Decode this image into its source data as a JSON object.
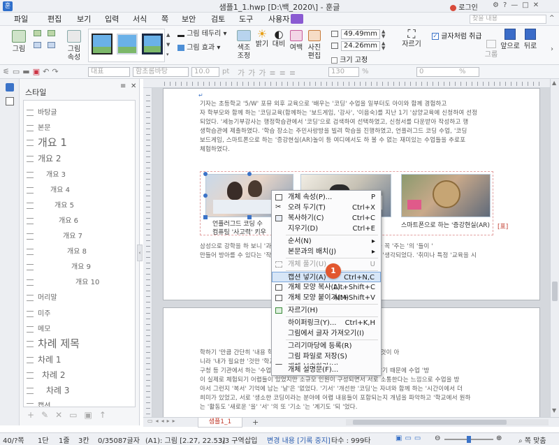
{
  "window": {
    "title": "샘플1_1.hwp [D:\\백_2020\\] - 훈글",
    "login_label": "로그인",
    "search_placeholder": "찾을 내용"
  },
  "menu": [
    "파일",
    "편집",
    "보기",
    "입력",
    "서식",
    "쪽",
    "보안",
    "검토",
    "도구",
    "사용자"
  ],
  "ribbon": {
    "picture": "그림",
    "picture_props_1": "그림",
    "picture_props_2": "속성",
    "border": "그림 테두리",
    "effect": "그림 효과",
    "color_adjust_1": "색조",
    "color_adjust_2": "조정",
    "brightness": "밝기",
    "contrast": "대비",
    "margin": "여백",
    "photo_edit_1": "사진",
    "photo_edit_2": "편집",
    "width_value": "49.49",
    "height_value": "24.26",
    "unit": "mm",
    "fix_size": "크기 고정",
    "crop": "자르기",
    "treat_as_text": "글자처럼 취급",
    "group": "그룹",
    "front": "앞으로",
    "back": "뒤로"
  },
  "toolbar": {
    "style": "대표",
    "font": "함초롬바탕",
    "size": "10.0",
    "size_unit": "pt",
    "line_spacing": "130",
    "line_spacing_unit": "%",
    "char_spacing": "0",
    "char_spacing_unit": "%"
  },
  "sidebar": {
    "title": "스타일",
    "styles": [
      "바탕글",
      "본문",
      "개요 1",
      "개요 2",
      "개요 3",
      "개요 4",
      "개요 5",
      "개요 6",
      "개요 7",
      "개요 8",
      "개요 9",
      "개요 10",
      "머리말",
      "미주",
      "메모",
      "차례 제목",
      "차례 1",
      "차례 2",
      "차례 3",
      "캡션"
    ]
  },
  "document": {
    "para1": [
      "기자는 초등학교 '5/W' 포뮤 외후 교육으로 '배우는 '코딩' 수업을 일부터도 아이와 함께 경험하고",
      "자 학부모와 함께 하는 '코딩교육(함께하는 '보드게임, '강사', '이음숙)를 지난 1기 '삼양교육에 신청하여 선정",
      "되었다. '세능기부강사는 행정학습관에서 '코딩'으로 검색하여 선택하였고, 신청서를 다운받아 작성하고 행",
      "생학습관에 제출하였다. '학습 장소는 주민사랑방을 빌려 학습을 진행하였고, 언플러그드 코딩 수업, '코딩",
      "보드게임, 스마트폰으로 하는 '증강현실(AR)놀이 등 여디에서도 하 볼 수 없는 재미있는 수업들을 추로포",
      "체험하였다."
    ],
    "caption_left_1": "언플러그드 코딩 수",
    "caption_left_2": "컴퓨팅 '사고력' 키우",
    "caption_right": "스마트폰으로 하는 '증강현실(AR)",
    "table_mark": "[표]",
    "para2": [
      "삼성으로 강학을 하 보니 '과정의 질 '프로그램 소개이다. 이러한 '기회를 꼭 '주는 '의 '들이 '",
      "만들어 방아를 수 있다는 '작은 기대 한 작은 모든 '프로그램을 입학하고 '생각되었다. '취미나 특정 '교육을 시"
    ],
    "para3": [
      "학하기 '만큼 간단히 '내용 학 '그림 '수도 '있고, 대단한 '내용을 배우는 것이 아",
      "니라 '내가 필요한 '것만 '학교 '수업 공부를 '해",
      "구청 등 기관에서 하는 '수업은 '대체 '분 '한 '모집 '은 '인원이 교육을 받기 때문에 수업 '방",
      "이 실제로 체험되기 어렵들이 있었지만 소규모 인원이 구성되면서 서로 소통한다는 느낌으로 수업을 방",
      "아서 그런지 '복서' 기억에 남는 '날'은 '없었다. '기서' '개선한 '코딩'는 자녀와 함께 하는 '시간이에서 더",
      "희미가 있었고, 서로 '생소한 코딩이라는 분야에 어렵 내용들이 포함되는지 개념을 파악하고 '학교에서 원하",
      "는 '활동도 '새로운 '을' '서' '의 또 '기소 '는 '계기도 '되 '었다."
    ]
  },
  "context_menu": {
    "items": [
      {
        "label": "개체 속성(P)...",
        "shortcut": "P",
        "icon": "properties-icon",
        "disabled": false,
        "highlight": false
      },
      {
        "label": "오려 두기(T)",
        "shortcut": "Ctrl+X",
        "icon": "scissors-icon",
        "disabled": false,
        "highlight": false
      },
      {
        "label": "복사하기(C)",
        "shortcut": "Ctrl+C",
        "icon": "copy-icon",
        "disabled": false,
        "highlight": false
      },
      {
        "label": "지우기(D)",
        "shortcut": "Ctrl+E",
        "icon": "",
        "disabled": false,
        "highlight": false
      },
      {
        "label": "순서(N)",
        "shortcut": "",
        "icon": "",
        "disabled": false,
        "highlight": false,
        "submenu": true
      },
      {
        "label": "본문과의 배치(J)",
        "shortcut": "",
        "icon": "",
        "disabled": false,
        "highlight": false,
        "submenu": true
      },
      {
        "label": "개체 풀기(U)",
        "shortcut": "U",
        "icon": "ungroup-icon",
        "disabled": true,
        "highlight": false
      },
      {
        "label": "캡션 넣기(A)",
        "shortcut": "Ctrl+N,C",
        "icon": "",
        "disabled": false,
        "highlight": true
      },
      {
        "label": "개체 모양 복사(L)...",
        "shortcut": "Alt+Shift+C",
        "icon": "format-copy-icon",
        "disabled": false,
        "highlight": false
      },
      {
        "label": "개체 모양 붙이기(M)",
        "shortcut": "Alt+Shift+V",
        "icon": "format-paste-icon",
        "disabled": false,
        "highlight": false
      },
      {
        "label": "자르기(H)",
        "shortcut": "",
        "icon": "crop-icon",
        "disabled": false,
        "highlight": false
      },
      {
        "label": "하이퍼링크(Y)...",
        "shortcut": "Ctrl+K,H",
        "icon": "",
        "disabled": false,
        "highlight": false
      },
      {
        "label": "그림에서 글자 가져오기(I)",
        "shortcut": "",
        "icon": "",
        "disabled": false,
        "highlight": false
      },
      {
        "label": "그리기마당에 등록(R)",
        "shortcut": "",
        "icon": "",
        "disabled": false,
        "highlight": false
      },
      {
        "label": "그림 파일로 저장(S)",
        "shortcut": "",
        "icon": "",
        "disabled": false,
        "highlight": false
      },
      {
        "label": "개체 보호하기(K)",
        "shortcut": "",
        "icon": "lock-icon",
        "disabled": false,
        "highlight": false
      },
      {
        "label": "개체 설명문(F)...",
        "shortcut": "",
        "icon": "",
        "disabled": false,
        "highlight": false
      }
    ],
    "badge": "1"
  },
  "tab": {
    "name": "샘플1_1"
  },
  "status": {
    "page": "40/?쪽",
    "section": "1단",
    "line": "1줄",
    "col": "3칸",
    "chars": "0/35087글자",
    "object": "(A1): 그림 [2.27, 22.53]",
    "region": "3/3 구역",
    "insert": "삽입",
    "change_tracking": "변경 내용 [기록 중지]",
    "typing": "타수 : 999타",
    "zoom": "쪽 맞춤"
  },
  "colors": {
    "accent": "#3b73c8",
    "badge": "#e2572f",
    "menu_highlight": "#d7e6f7",
    "hancom_tab": "#8a5bd2"
  }
}
